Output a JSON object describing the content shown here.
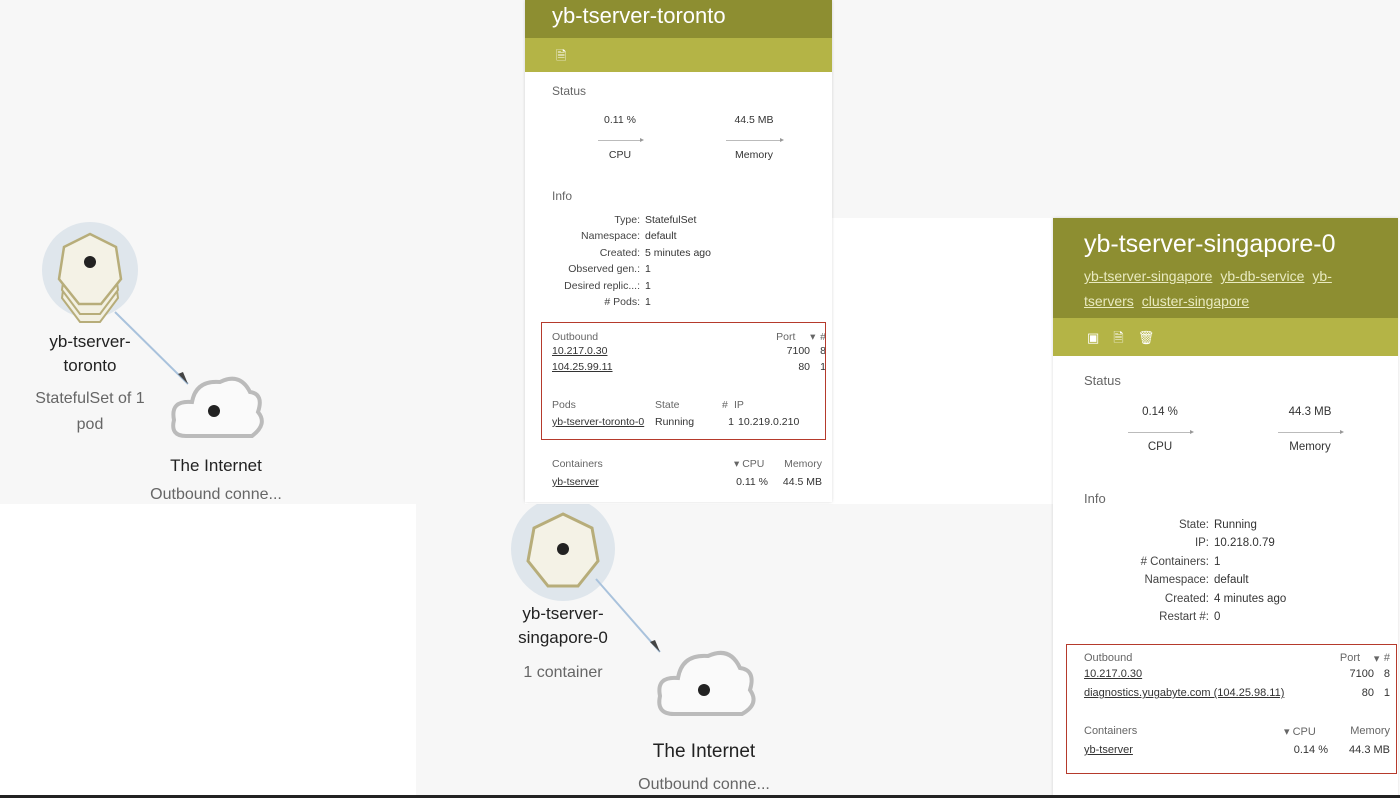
{
  "left_graph": {
    "node": {
      "name_line1": "yb-tserver-",
      "name_line2": "toronto",
      "sub_line1": "StatefulSet of 1",
      "sub_line2": "pod"
    },
    "internet": {
      "name": "The Internet",
      "sub": "Outbound conne..."
    }
  },
  "center_graph": {
    "node": {
      "name_line1": "yb-tserver-",
      "name_line2": "singapore-0",
      "sub": "1 container"
    },
    "internet": {
      "name": "The Internet",
      "sub": "Outbound conne..."
    }
  },
  "toronto_panel": {
    "title": "yb-tserver-toronto",
    "status_title": "Status",
    "cpu": {
      "value": "0.11 %",
      "label": "CPU"
    },
    "memory": {
      "value": "44.5 MB",
      "label": "Memory"
    },
    "info_title": "Info",
    "info": [
      {
        "k": "Type:",
        "v": "StatefulSet"
      },
      {
        "k": "Namespace:",
        "v": "default"
      },
      {
        "k": "Created:",
        "v": "5 minutes ago"
      },
      {
        "k": "Observed gen.:",
        "v": "1"
      },
      {
        "k": "Desired replic...:",
        "v": "1"
      },
      {
        "k": "# Pods:",
        "v": "1"
      }
    ],
    "outbound": {
      "headers": {
        "name": "Outbound",
        "port": "Port",
        "sort": "▾",
        "count": "#"
      },
      "rows": [
        {
          "ip": "10.217.0.30",
          "port": "7100",
          "count": "8"
        },
        {
          "ip": "104.25.99.11",
          "port": "80",
          "count": "1"
        }
      ]
    },
    "pods": {
      "headers": {
        "name": "Pods",
        "state": "State",
        "count": "#",
        "ip": "IP"
      },
      "rows": [
        {
          "name": "yb-tserver-toronto-0",
          "state": "Running",
          "count": "1",
          "ip": "10.219.0.210"
        }
      ]
    },
    "containers": {
      "headers": {
        "name": "Containers",
        "cpu": "▾ CPU",
        "memory": "Memory"
      },
      "rows": [
        {
          "name": "yb-tserver",
          "cpu": "0.11 %",
          "memory": "44.5 MB"
        }
      ]
    }
  },
  "singapore_panel": {
    "title": "yb-tserver-singapore-0",
    "links": [
      "yb-tserver-singapore",
      "yb-db-service",
      "yb-tservers",
      "cluster-singapore"
    ],
    "status_title": "Status",
    "cpu": {
      "value": "0.14 %",
      "label": "CPU"
    },
    "memory": {
      "value": "44.3 MB",
      "label": "Memory"
    },
    "info_title": "Info",
    "info": [
      {
        "k": "State:",
        "v": "Running"
      },
      {
        "k": "IP:",
        "v": "10.218.0.79"
      },
      {
        "k": "# Containers:",
        "v": "1"
      },
      {
        "k": "Namespace:",
        "v": "default"
      },
      {
        "k": "Created:",
        "v": "4 minutes ago"
      },
      {
        "k": "Restart #:",
        "v": "0"
      }
    ],
    "outbound": {
      "headers": {
        "name": "Outbound",
        "port": "Port",
        "sort": "▾",
        "count": "#"
      },
      "rows": [
        {
          "ip": "10.217.0.30",
          "port": "7100",
          "count": "8"
        },
        {
          "ip": "diagnostics.yugabyte.com (104.25.98.11)",
          "port": "80",
          "count": "1"
        }
      ]
    },
    "containers": {
      "headers": {
        "name": "Containers",
        "cpu": "▾ CPU",
        "memory": "Memory"
      },
      "rows": [
        {
          "name": "yb-tserver",
          "cpu": "0.14 %",
          "memory": "44.3 MB"
        }
      ]
    }
  },
  "icons": [
    "document-icon",
    "monitor-icon",
    "trash-icon"
  ],
  "colors": {
    "header_olive": "#8d8e31",
    "toolbar_olive": "#b4b446",
    "highlight_red": "#b53a2c"
  }
}
